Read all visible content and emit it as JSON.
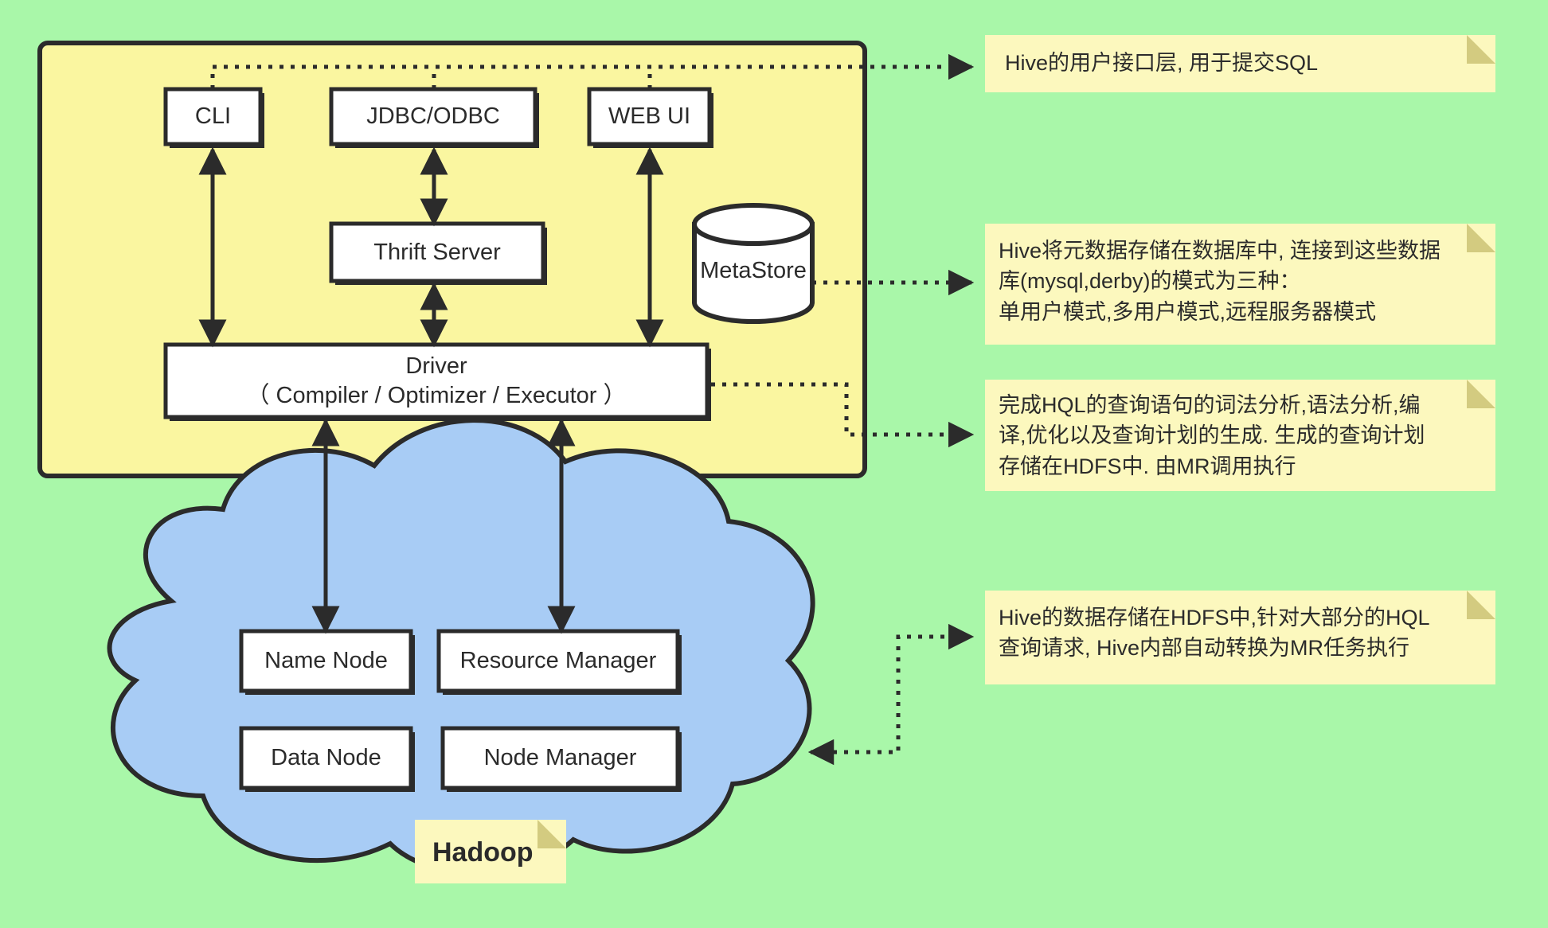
{
  "colors": {
    "background": "#A9F7A9",
    "hive_container_fill": "#FAF6A0",
    "note_fill": "#FCF8BE",
    "note_fold": "#D3CB80",
    "cloud_fill": "#A8CCF5",
    "box_fill": "#FFFFFF",
    "stroke": "#2B2B2B"
  },
  "hive": {
    "container_name": "hive-container",
    "boxes": [
      {
        "id": "cli",
        "label": "CLI"
      },
      {
        "id": "jdbc-odbc",
        "label": "JDBC/ODBC"
      },
      {
        "id": "web-ui",
        "label": "WEB UI"
      },
      {
        "id": "thrift-server",
        "label": "Thrift Server"
      },
      {
        "id": "driver",
        "label": "Driver\n（ Compiler / Optimizer / Executor ）"
      }
    ],
    "metastore": {
      "id": "metastore",
      "label": "MetaStore"
    }
  },
  "hadoop": {
    "cloud_name": "hadoop-cloud",
    "title": "Hadoop",
    "boxes": [
      {
        "id": "name-node",
        "label": "Name Node"
      },
      {
        "id": "resource-manager",
        "label": "Resource Manager"
      },
      {
        "id": "data-node",
        "label": "Data Node"
      },
      {
        "id": "node-manager",
        "label": "Node Manager"
      }
    ]
  },
  "notes": [
    {
      "id": "note-user-interface",
      "text": "Hive的用户接口层, 用于提交SQL"
    },
    {
      "id": "note-metastore",
      "text": "Hive将元数据存储在数据库中, 连接到这些数据\n库(mysql,derby)的模式为三种：\n单用户模式,多用户模式,远程服务器模式"
    },
    {
      "id": "note-driver",
      "text": "完成HQL的查询语句的词法分析,语法分析,编\n译,优化以及查询计划的生成. 生成的查询计划\n存储在HDFS中. 由MR调用执行"
    },
    {
      "id": "note-hdfs",
      "text": "Hive的数据存储在HDFS中,针对大部分的HQL\n查询请求, Hive内部自动转换为MR任务执行"
    }
  ]
}
